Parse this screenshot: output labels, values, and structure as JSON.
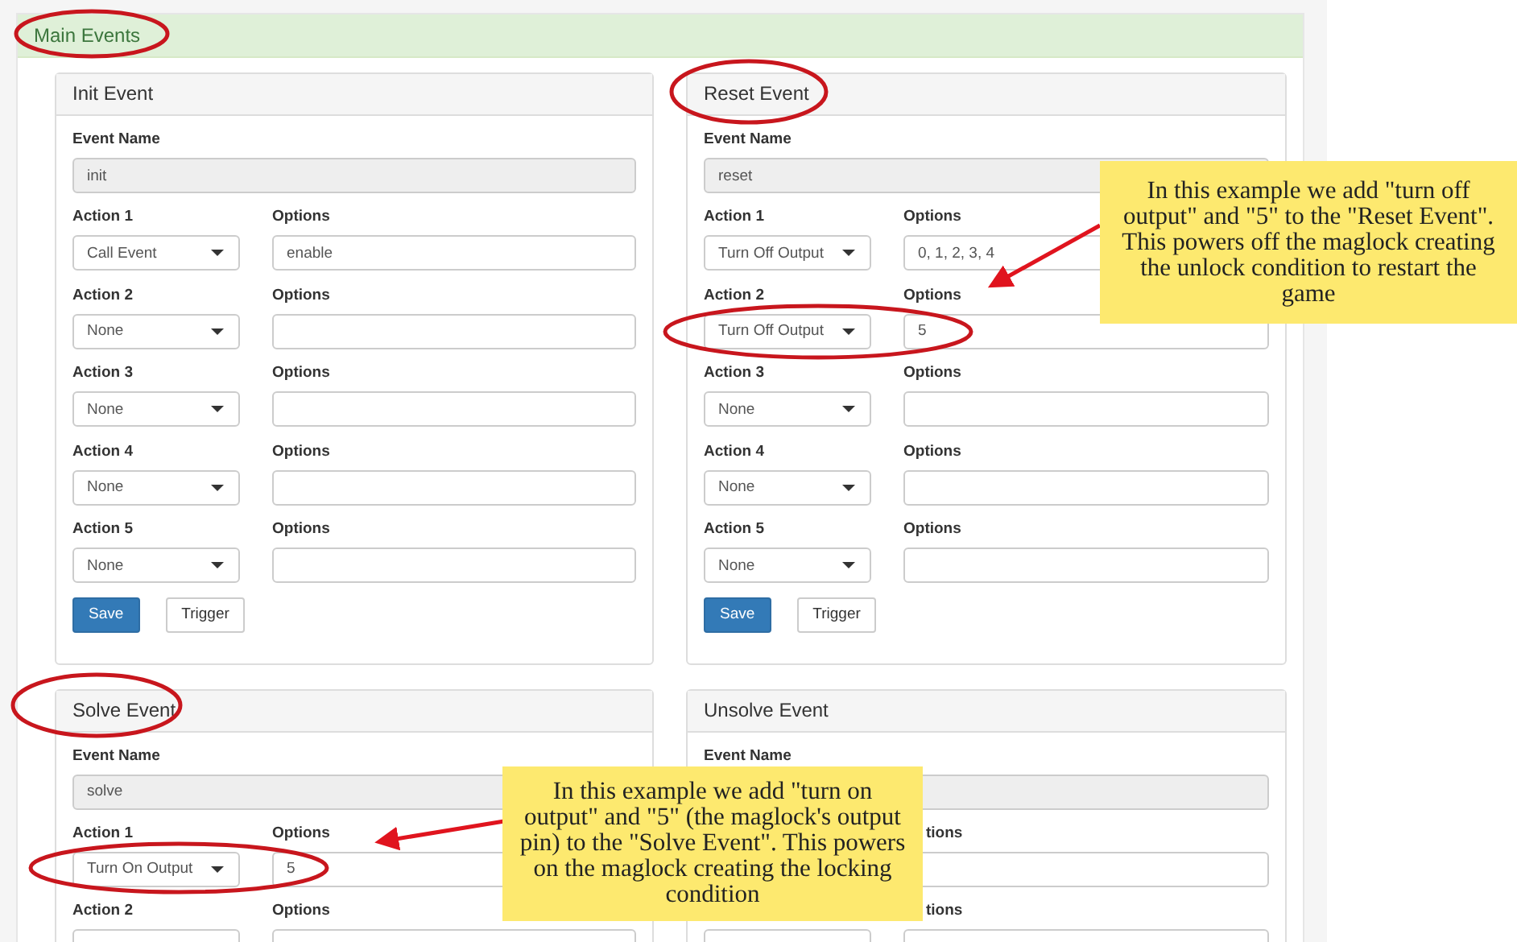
{
  "main": {
    "title": "Main Events"
  },
  "panels": [
    {
      "title": "Init Event",
      "event_name_label": "Event Name",
      "event_name": "init",
      "actions": [
        {
          "label": "Action 1",
          "select": "Call Event",
          "options_label": "Options",
          "value": "enable"
        },
        {
          "label": "Action 2",
          "select": "None",
          "options_label": "Options"
        },
        {
          "label": "Action 3",
          "select": "None",
          "options_label": "Options"
        },
        {
          "label": "Action 4",
          "select": "None",
          "options_label": "Options"
        },
        {
          "label": "Action 5",
          "select": "None",
          "options_label": "Options"
        }
      ],
      "buttons": [
        {
          "label": "Save",
          "kind": "primary"
        },
        {
          "label": "Trigger",
          "kind": "default"
        }
      ]
    },
    {
      "title": "Reset Event",
      "event_name_label": "Event Name",
      "event_name": "reset",
      "actions": [
        {
          "label": "Action 1",
          "select": "Turn Off Output",
          "options_label": "Options",
          "value": "0, 1, 2, 3, 4"
        },
        {
          "label": "Action 2",
          "select": "Turn Off Output",
          "options_label": "Options",
          "value": "5"
        },
        {
          "label": "Action 3",
          "select": "None",
          "options_label": "Options"
        },
        {
          "label": "Action 4",
          "select": "None",
          "options_label": "Options"
        },
        {
          "label": "Action 5",
          "select": "None",
          "options_label": "Options"
        }
      ],
      "buttons": [
        {
          "label": "Save",
          "kind": "primary"
        },
        {
          "label": "Trigger",
          "kind": "default"
        }
      ]
    },
    {
      "title": "Solve Event",
      "event_name_label": "Event Name",
      "event_name": "solve",
      "actions": [
        {
          "label": "Action 1",
          "select": "Turn On Output",
          "options_label": "Options",
          "value": "5"
        },
        {
          "label": "Action 2",
          "dropdown": true,
          "options_label": "Options"
        }
      ]
    },
    {
      "title": "Unsolve Event",
      "event_name_label": "Event Name",
      "actions": [
        {
          "options_label": "tions"
        },
        {
          "dropdown": true,
          "options_label": "tions"
        }
      ]
    }
  ],
  "callouts": [
    {
      "text": "In this example we add \"turn off output\" and \"5\" to the \"Reset Event\". This powers off the maglock creating the unlock condition to restart the game"
    },
    {
      "text": "In this example we add \"turn on output\" and \"5\" (the maglock's output pin) to the \"Solve Event\". This powers on the maglock creating the locking condition"
    }
  ]
}
